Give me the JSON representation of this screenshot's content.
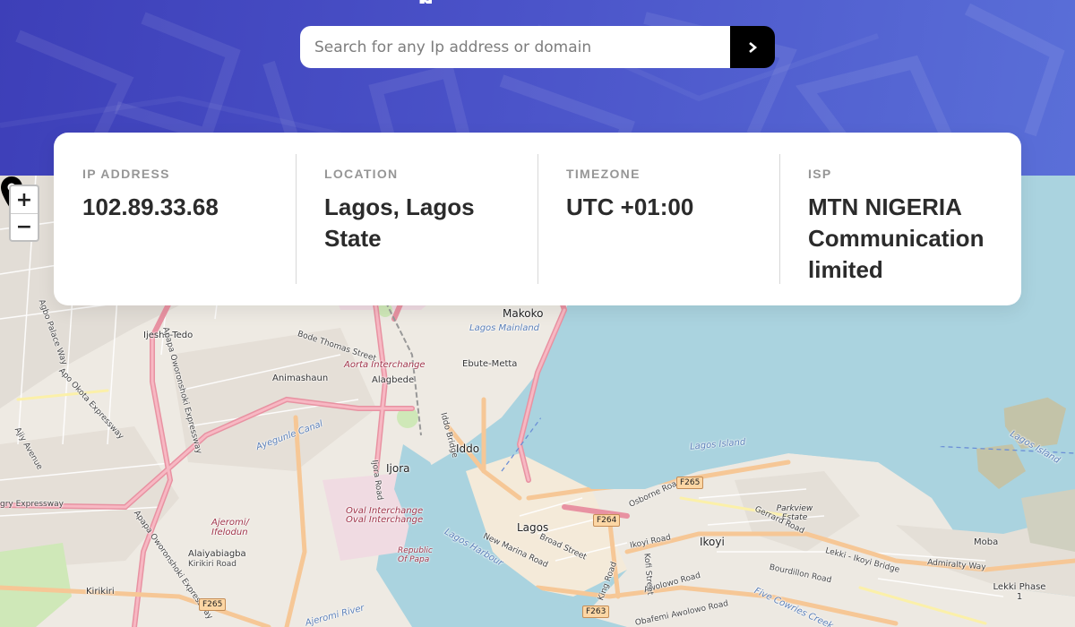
{
  "header": {
    "title_fragment": "p"
  },
  "search": {
    "placeholder": "Search for any Ip address or domain",
    "button_icon": "chevron-right-icon"
  },
  "info": {
    "ip": {
      "label": "IP ADDRESS",
      "value": "102.89.33.68"
    },
    "location": {
      "label": "LOCATION",
      "value": "Lagos, Lagos State"
    },
    "timezone": {
      "label": "TIMEZONE",
      "value": "UTC +01:00"
    },
    "isp": {
      "label": "ISP",
      "value": "MTN NIGERIA Communication limited"
    }
  },
  "map": {
    "zoom_in": "+",
    "zoom_out": "−",
    "marker_icon": "map-marker-icon",
    "places": {
      "makoko": "Makoko",
      "lagos_mainland": "Lagos Mainland",
      "ijesha_tedo": "Ijesha-Tedo",
      "bode_thomas": "Bode Thomas Street",
      "aorta": "Aorta Interchange",
      "animashaun": "Animashaun",
      "alagbede": "Alagbede",
      "ebute_metta": "Ebute-Metta",
      "iddo": "Iddo",
      "ijora": "Ijora",
      "lagos": "Lagos",
      "lagos_island": "Lagos Island",
      "lagos_island_2": "Lagos Island",
      "parkview": "Parkview Estate",
      "ikoyi": "Ikoyi",
      "moba": "Moba",
      "lekki_phase": "Lekki Phase 1",
      "oval_1": "Oval Interchange",
      "oval_2": "Oval Interchange",
      "republic": "Republic Of Papa",
      "ajeromi": "Ajeromi/ Ifelodun",
      "alaiyabiagba": "Alaiyabiagba",
      "kirikiri_road": "Kirikiri Road",
      "kirikiri": "Kirikiri",
      "lagos_harbour": "Lagos Harbour",
      "ogry": "gry Expressway",
      "ijora_road": "Ijora Road",
      "apapa_oworon": "Apapa Oworonshoki Expressway",
      "apapa_oworon_2": "Apapa Oworonshoki Expressway",
      "apo_okota": "Apo Okota Expressway",
      "agbo_palace": "Agbo Palace Way",
      "ajiy_avenue": "Ajiy Avenue",
      "new_marina": "New Marina Road",
      "broad_street": "Broad Street",
      "ikoyi_road": "Ikoyi Road",
      "osborne": "Osborne Road",
      "gerrard": "Gerrard Road",
      "bourdillon": "Bourdillon Road",
      "admiralty": "Admiralty Way",
      "lekki_ikoyi": "Lekki - Ikoyi Bridge",
      "five_cowries": "Five Cowries Creek",
      "awolowo": "Awolowo Road",
      "obafemi": "Obafemi Awolowo Road",
      "kofi": "Kofi Street",
      "king": "King Road",
      "iddo_bridge": "Iddo Bridge",
      "ayegunle": "Ayegunle Canal",
      "ajeromi_river": "Ajeromi River"
    },
    "shields": {
      "f265_a": "F265",
      "f264": "F264",
      "f263": "F263",
      "f265_b": "F265"
    }
  }
}
